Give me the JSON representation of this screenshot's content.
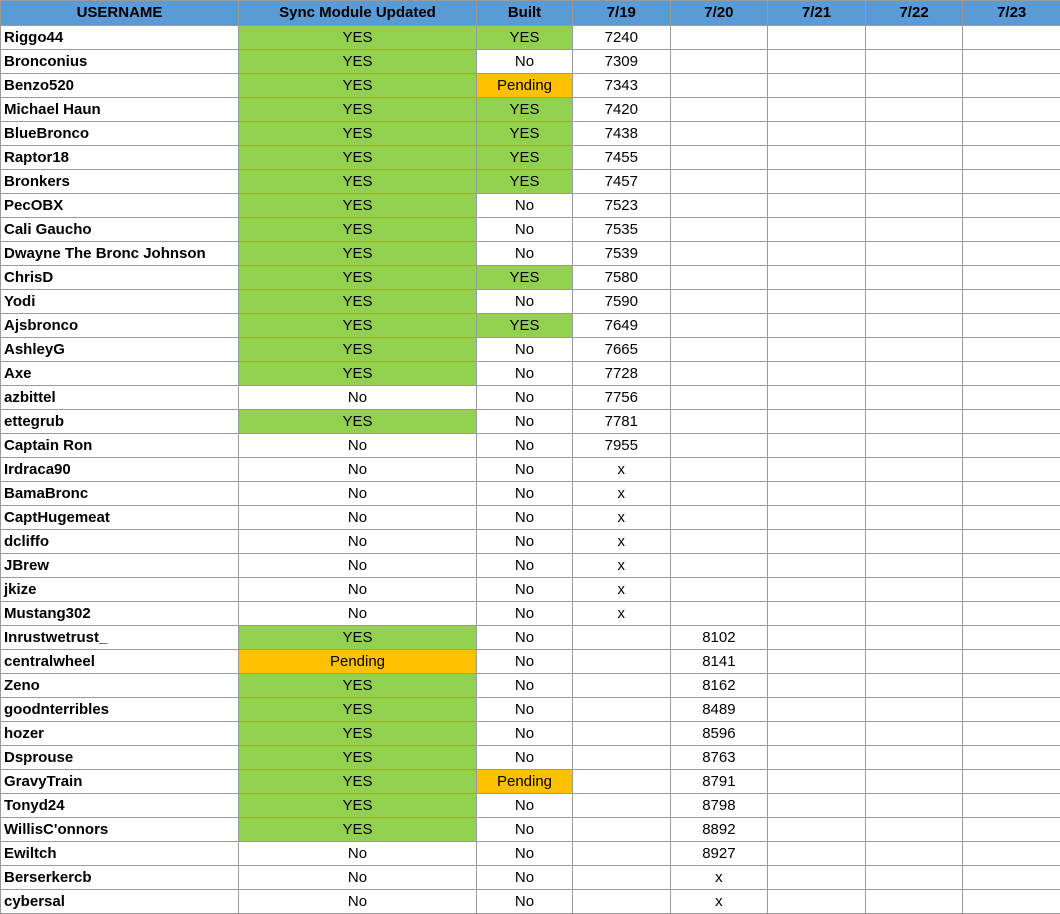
{
  "colors": {
    "header": "#5b9bd5",
    "yes": "#92d050",
    "pending": "#ffc000",
    "no": "#ffffff",
    "grid": "#9a9a9a"
  },
  "headers": [
    "USERNAME",
    "Sync Module Updated",
    "Built",
    "7/19",
    "7/20",
    "7/21",
    "7/22",
    "7/23"
  ],
  "rows": [
    {
      "user": "Riggo44",
      "sync": "YES",
      "built": "YES",
      "dates": [
        "7240",
        "",
        "",
        "",
        ""
      ]
    },
    {
      "user": "Bronconius",
      "sync": "YES",
      "built": "No",
      "dates": [
        "7309",
        "",
        "",
        "",
        ""
      ]
    },
    {
      "user": "Benzo520",
      "sync": "YES",
      "built": "Pending",
      "dates": [
        "7343",
        "",
        "",
        "",
        ""
      ]
    },
    {
      "user": "Michael Haun",
      "sync": "YES",
      "built": "YES",
      "dates": [
        "7420",
        "",
        "",
        "",
        ""
      ]
    },
    {
      "user": "BlueBronco",
      "sync": "YES",
      "built": "YES",
      "dates": [
        "7438",
        "",
        "",
        "",
        ""
      ]
    },
    {
      "user": "Raptor18",
      "sync": "YES",
      "built": "YES",
      "dates": [
        "7455",
        "",
        "",
        "",
        ""
      ]
    },
    {
      "user": "Bronkers",
      "sync": "YES",
      "built": "YES",
      "dates": [
        "7457",
        "",
        "",
        "",
        ""
      ]
    },
    {
      "user": "PecOBX",
      "sync": "YES",
      "built": "No",
      "dates": [
        "7523",
        "",
        "",
        "",
        ""
      ]
    },
    {
      "user": "Cali Gaucho",
      "sync": "YES",
      "built": "No",
      "dates": [
        "7535",
        "",
        "",
        "",
        ""
      ]
    },
    {
      "user": "Dwayne The Bronc Johnson",
      "sync": "YES",
      "built": "No",
      "dates": [
        "7539",
        "",
        "",
        "",
        ""
      ]
    },
    {
      "user": "ChrisD",
      "sync": "YES",
      "built": "YES",
      "dates": [
        "7580",
        "",
        "",
        "",
        ""
      ]
    },
    {
      "user": "Yodi",
      "sync": "YES",
      "built": "No",
      "dates": [
        "7590",
        "",
        "",
        "",
        ""
      ]
    },
    {
      "user": "Ajsbronco",
      "sync": "YES",
      "built": "YES",
      "dates": [
        "7649",
        "",
        "",
        "",
        ""
      ]
    },
    {
      "user": "AshleyG",
      "sync": "YES",
      "built": "No",
      "dates": [
        "7665",
        "",
        "",
        "",
        ""
      ]
    },
    {
      "user": "Axe",
      "sync": "YES",
      "built": "No",
      "dates": [
        "7728",
        "",
        "",
        "",
        ""
      ]
    },
    {
      "user": "azbittel",
      "sync": "No",
      "built": "No",
      "dates": [
        "7756",
        "",
        "",
        "",
        ""
      ]
    },
    {
      "user": "ettegrub",
      "sync": "YES",
      "built": "No",
      "dates": [
        "7781",
        "",
        "",
        "",
        ""
      ]
    },
    {
      "user": "Captain Ron",
      "sync": "No",
      "built": "No",
      "dates": [
        "7955",
        "",
        "",
        "",
        ""
      ]
    },
    {
      "user": "Irdraca90",
      "sync": "No",
      "built": "No",
      "dates": [
        "x",
        "",
        "",
        "",
        ""
      ]
    },
    {
      "user": "BamaBronc",
      "sync": "No",
      "built": "No",
      "dates": [
        "x",
        "",
        "",
        "",
        ""
      ]
    },
    {
      "user": "CaptHugemeat",
      "sync": "No",
      "built": "No",
      "dates": [
        "x",
        "",
        "",
        "",
        ""
      ]
    },
    {
      "user": "dcliffo",
      "sync": "No",
      "built": "No",
      "dates": [
        "x",
        "",
        "",
        "",
        ""
      ]
    },
    {
      "user": "JBrew",
      "sync": "No",
      "built": "No",
      "dates": [
        "x",
        "",
        "",
        "",
        ""
      ]
    },
    {
      "user": "jkize",
      "sync": "No",
      "built": "No",
      "dates": [
        "x",
        "",
        "",
        "",
        ""
      ]
    },
    {
      "user": "Mustang302",
      "sync": "No",
      "built": "No",
      "dates": [
        "x",
        "",
        "",
        "",
        ""
      ]
    },
    {
      "user": "Inrustwetrust_",
      "sync": "YES",
      "built": "No",
      "dates": [
        "",
        "8102",
        "",
        "",
        ""
      ]
    },
    {
      "user": "centralwheel",
      "sync": "Pending",
      "built": "No",
      "dates": [
        "",
        "8141",
        "",
        "",
        ""
      ]
    },
    {
      "user": "Zeno",
      "sync": "YES",
      "built": "No",
      "dates": [
        "",
        "8162",
        "",
        "",
        ""
      ]
    },
    {
      "user": "goodnterribles",
      "sync": "YES",
      "built": "No",
      "dates": [
        "",
        "8489",
        "",
        "",
        ""
      ]
    },
    {
      "user": "hozer",
      "sync": "YES",
      "built": "No",
      "dates": [
        "",
        "8596",
        "",
        "",
        ""
      ]
    },
    {
      "user": "Dsprouse",
      "sync": "YES",
      "built": "No",
      "dates": [
        "",
        "8763",
        "",
        "",
        ""
      ]
    },
    {
      "user": "GravyTrain",
      "sync": "YES",
      "built": "Pending",
      "dates": [
        "",
        "8791",
        "",
        "",
        ""
      ]
    },
    {
      "user": "Tonyd24",
      "sync": "YES",
      "built": "No",
      "dates": [
        "",
        "8798",
        "",
        "",
        ""
      ]
    },
    {
      "user": "WillisC'onnors",
      "sync": "YES",
      "built": "No",
      "dates": [
        "",
        "8892",
        "",
        "",
        ""
      ]
    },
    {
      "user": "Ewiltch",
      "sync": "No",
      "built": "No",
      "dates": [
        "",
        "8927",
        "",
        "",
        ""
      ]
    },
    {
      "user": "Berserkercb",
      "sync": "No",
      "built": "No",
      "dates": [
        "",
        "x",
        "",
        "",
        ""
      ]
    },
    {
      "user": "cybersal",
      "sync": "No",
      "built": "No",
      "dates": [
        "",
        "x",
        "",
        "",
        ""
      ]
    }
  ]
}
